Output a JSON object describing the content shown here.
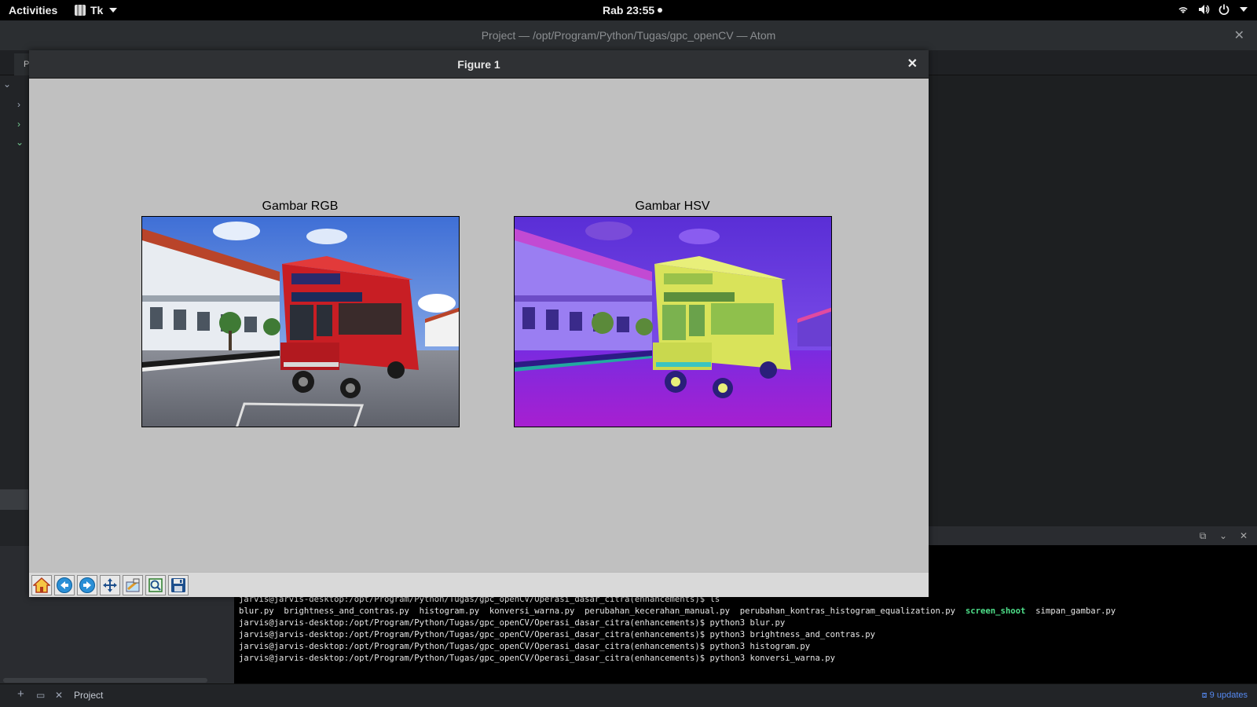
{
  "topbar": {
    "activities": "Activities",
    "app_name": "Tk",
    "clock": "Rab 23:55",
    "icons": [
      "wifi-icon",
      "volume-icon",
      "power-icon",
      "chevron-down-icon"
    ]
  },
  "atom": {
    "window_title": "Project — /opt/Program/Python/Tugas/gpc_openCV — Atom",
    "close_glyph": "✕",
    "tab_label": "P",
    "statusbar": {
      "project": "Project",
      "updates": "9 updates"
    }
  },
  "figure": {
    "title": "Figure 1",
    "close_glyph": "✕",
    "subplots": [
      {
        "title": "Gambar RGB"
      },
      {
        "title": "Gambar HSV"
      }
    ],
    "toolbar": [
      "home-icon",
      "back-icon",
      "forward-icon",
      "pan-icon",
      "configure-subplots-icon",
      "zoom-rect-icon",
      "save-icon"
    ]
  },
  "terminal": {
    "lines": [
      "jarvis@jarvis-desktop:/opt/Program/Python/Tugas/gpc_openCV/Operasi_dasar_citra(enhancements)$ ls",
      "jarvis@jarvis-desktop:/opt/Program/Python/Tugas/gpc_openCV/Operasi_dasar_citra(enhancements)$ python3 blur.py",
      "jarvis@jarvis-desktop:/opt/Program/Python/Tugas/gpc_openCV/Operasi_dasar_citra(enhancements)$ python3 brightness_and_contras.py",
      "jarvis@jarvis-desktop:/opt/Program/Python/Tugas/gpc_openCV/Operasi_dasar_citra(enhancements)$ python3 histogram.py",
      "jarvis@jarvis-desktop:/opt/Program/Python/Tugas/gpc_openCV/Operasi_dasar_citra(enhancements)$ python3 konversi_warna.py"
    ],
    "ls_output_before": "blur.py  brightness_and_contras.py  histogram.py  konversi_warna.py  perubahan_kecerahan_manual.py  perubahan_kontras_histogram_equalization.py  ",
    "ls_highlight": "screen_shoot",
    "ls_output_after": "  simpan_gambar.py"
  }
}
